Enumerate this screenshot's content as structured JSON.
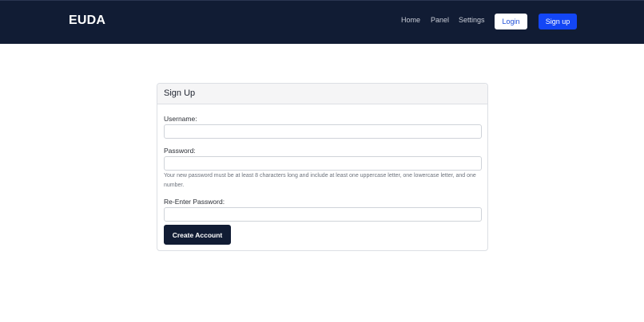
{
  "navbar": {
    "brand": "EUDA",
    "links": [
      {
        "label": "Home"
      },
      {
        "label": "Panel"
      },
      {
        "label": "Settings"
      }
    ],
    "login_label": "Login",
    "signup_label": "Sign up"
  },
  "form": {
    "title": "Sign Up",
    "username_label": "Username:",
    "username_value": "",
    "password_label": "Password:",
    "password_value": "",
    "password_help": "Your new password must be at least 8 characters long and include at least one uppercase letter, one lowercase letter, and one number.",
    "reenter_label": "Re-Enter Password:",
    "reenter_value": "",
    "submit_label": "Create Account"
  },
  "colors": {
    "navbar_bg": "#111c34",
    "primary": "#1346f5",
    "login_text": "#1d4ed8"
  }
}
